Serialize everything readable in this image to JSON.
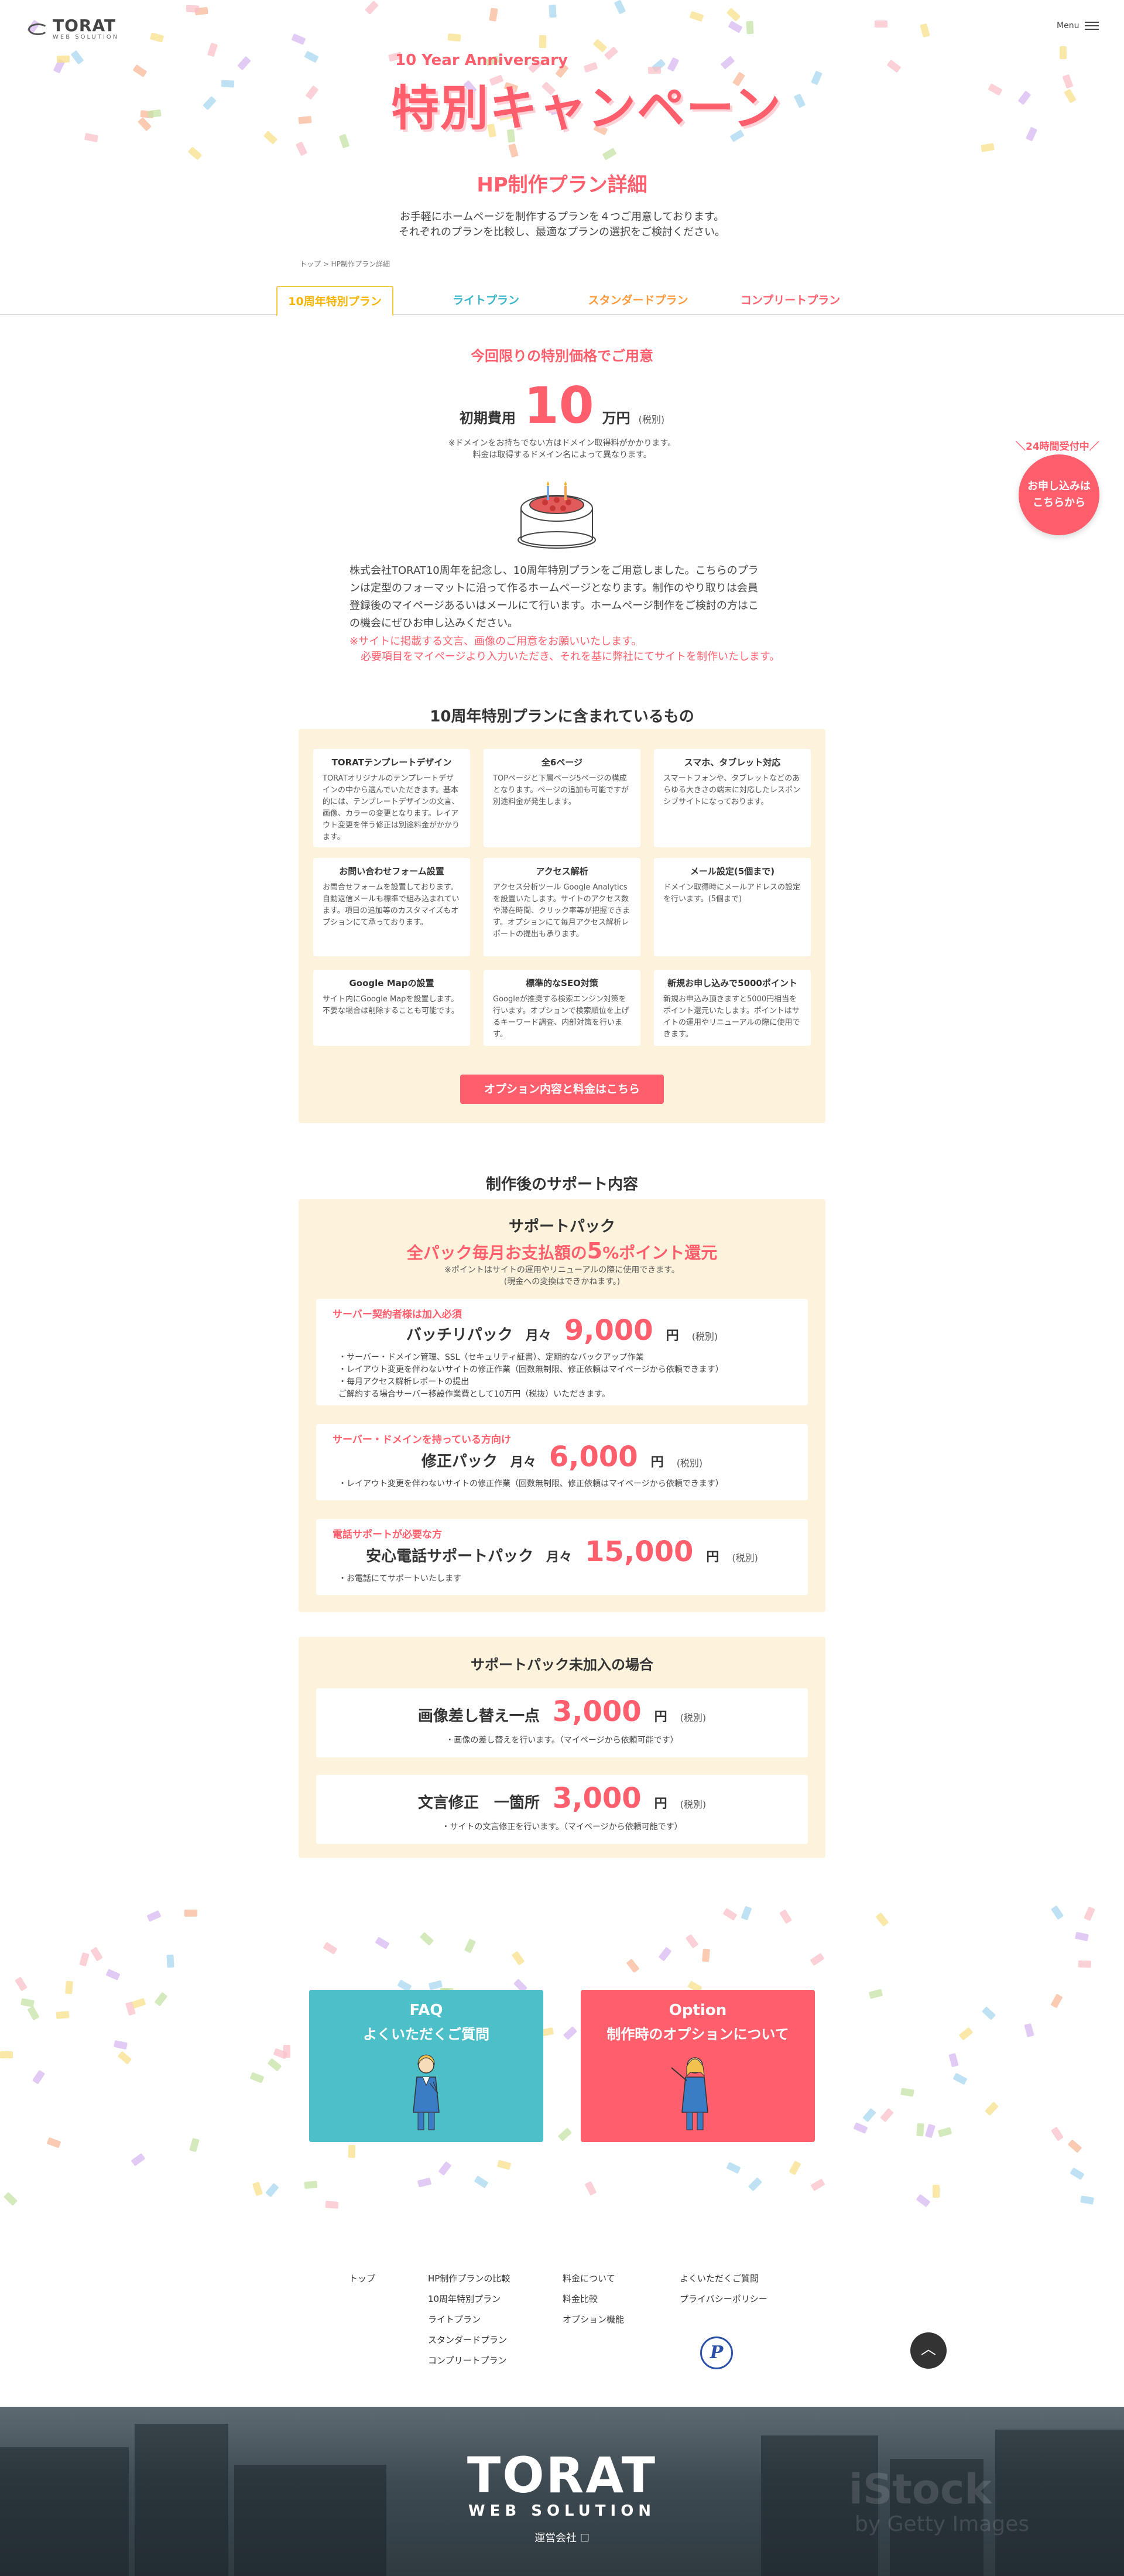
{
  "header": {
    "logo_name": "TORAT",
    "logo_sub": "WEB SOLUTION",
    "menu_label": "Menu"
  },
  "hero": {
    "anniversary": "10 Year Anniversary",
    "campaign": "特別キャンペーン"
  },
  "page": {
    "title": "HP制作プラン詳細",
    "intro_1": "お手軽にホームページを制作するプランを４つご用意しております。",
    "intro_2": "それぞれのプランを比較し、最適なプランの選択をご検討ください。",
    "breadcrumb": "トップ > HP制作プラン詳細"
  },
  "tabs": [
    {
      "label": "10周年特別プラン",
      "color": "#f5b400"
    },
    {
      "label": "ライトプラン",
      "color": "#39b6c8"
    },
    {
      "label": "スタンダードプラン",
      "color": "#ff9a3c"
    },
    {
      "label": "コンプリートプラン",
      "color": "#ff5e6c"
    }
  ],
  "offer": {
    "headline": "今回限りの特別価格でご用意",
    "price_label": "初期費用",
    "price_value": "10",
    "price_unit": "万円",
    "price_tax": "(税別)",
    "note_1": "※ドメインをお持ちでない方はドメイン取得料がかかります。",
    "note_2": "料金は取得するドメイン名によって異なります。",
    "description": "株式会社TORAT10周年を記念し、10周年特別プランをご用意しました。こちらのプランは定型のフォーマットに沿って作るホームページとなります。制作のやり取りは会員登録後のマイページあるいはメールにて行います。ホームページ制作をご検討の方はこの機会にぜひお申し込みください。",
    "warning_1": "※サイトに掲載する文言、画像のご用意をお願いいたします。",
    "warning_2": "必要項目をマイページより入力いただき、それを基に弊社にてサイトを制作いたします。"
  },
  "badge": {
    "top": "＼24時間受付中／",
    "line_1": "お申し込みは",
    "line_2": "こちらから"
  },
  "features": {
    "title": "10周年特別プランに含まれているもの",
    "items": [
      {
        "title": "TORATテンプレートデザイン",
        "desc": "TORATオリジナルのテンプレートデザインの中から選んでいただきます。基本的には、テンプレートデザインの文言、画像、カラーの変更となります。レイアウト変更を伴う修正は別途料金がかかります。"
      },
      {
        "title": "全6ページ",
        "desc": "TOPページと下層ページ5ページの構成となります。ページの追加も可能ですが別途料金が発生します。"
      },
      {
        "title": "スマホ、タブレット対応",
        "desc": "スマートフォンや、タブレットなどのあらゆる大きさの端末に対応したレスポンシブサイトになっております。"
      },
      {
        "title": "お問い合わせフォーム設置",
        "desc": "お問合せフォームを設置しております。自動返信メールも標準で組み込まれています。項目の追加等のカスタマイズもオプションにて承っております。"
      },
      {
        "title": "アクセス解析",
        "desc": "アクセス分析ツール Google Analytics を設置いたします。サイトのアクセス数や滞在時間、クリック率等が把握できます。オプションにて毎月アクセス解析レポートの提出も承ります。"
      },
      {
        "title": "メール設定(5個まで)",
        "desc": "ドメイン取得時にメールアドレスの設定を行います。(5個まで)"
      },
      {
        "title": "Google Mapの設置",
        "desc": "サイト内にGoogle Mapを設置します。不要な場合は削除することも可能です。"
      },
      {
        "title": "標準的なSEO対策",
        "desc": "Googleが推奨する検索エンジン対策を行います。オプションで検索順位を上げるキーワード調査、内部対策を行います。"
      },
      {
        "title": "新規お申し込みで5000ポイント",
        "desc": "新規お申込み頂きますと5000円相当をポイント還元いたします。ポイントはサイトの運用やリニューアルの際に使用できます。"
      }
    ],
    "button": "オプション内容と料金はこちら"
  },
  "support": {
    "section_title": "制作後のサポート内容",
    "box_title": "サポートパック",
    "highlight_pre": "全パック毎月お支払額の",
    "highlight_num": "5",
    "highlight_post": "%ポイント還元",
    "note_1": "※ポイントはサイトの運用やリニューアルの際に使用できます。",
    "note_2": "(現金への変換はできかねます。)",
    "packs": [
      {
        "caption": "サーバー契約者様は加入必須",
        "name": "バッチリパック",
        "monthly": "月々",
        "price": "9,000",
        "yen": "円",
        "tax": "(税別)",
        "items": [
          "・サーバー・ドメイン管理、SSL（セキュリティ証書）、定期的なバックアップ作業",
          "・レイアウト変更を伴わないサイトの修正作業（回数無制限、修正依頼はマイページから依頼できます）",
          "・毎月アクセス解析レポートの提出",
          "ご解約する場合サーバー移設作業費として10万円（税抜）いただきます。"
        ]
      },
      {
        "caption": "サーバー・ドメインを持っている方向け",
        "name": "修正パック",
        "monthly": "月々",
        "price": "6,000",
        "yen": "円",
        "tax": "(税別)",
        "items": [
          "・レイアウト変更を伴わないサイトの修正作業（回数無制限、修正依頼はマイページから依頼できます）"
        ]
      },
      {
        "caption": "電話サポートが必要な方",
        "name": "安心電話サポートパック",
        "monthly": "月々",
        "price": "15,000",
        "yen": "円",
        "tax": "(税別)",
        "items": [
          "・お電話にてサポートいたします"
        ]
      }
    ]
  },
  "no_support": {
    "title": "サポートパック未加入の場合",
    "items": [
      {
        "name": "画像差し替え一点",
        "price": "3,000",
        "yen": "円",
        "tax": "(税別)",
        "note": "・画像の差し替えを行います。（マイページから依頼可能です）"
      },
      {
        "name": "文言修正　一箇所",
        "price": "3,000",
        "yen": "円",
        "tax": "(税別)",
        "note": "・サイトの文言修正を行います。（マイページから依頼可能です）"
      }
    ]
  },
  "cards": [
    {
      "en": "FAQ",
      "jp": "よくいただくご質問",
      "color": "#4dbfc9"
    },
    {
      "en": "Option",
      "jp": "制作時のオプションについて",
      "color": "#ff5e6c"
    }
  ],
  "footer": {
    "col1": [
      "トップ"
    ],
    "col2": [
      "HP制作プランの比較",
      "10周年特別プラン",
      "ライトプラン",
      "スタンダードプラン",
      "コンプリートプラン"
    ],
    "col3": [
      "料金について",
      "料金比較",
      "オプション機能"
    ],
    "col4": [
      "よくいただくご質問",
      "プライバシーポリシー"
    ],
    "privacy_mark": "P",
    "to_top": "︿",
    "logo_name": "TORAT",
    "logo_sub": "WEB SOLUTION",
    "company": "運営会社 ☐",
    "watermark": "iStock",
    "watermark_sub": "by Getty Images"
  }
}
